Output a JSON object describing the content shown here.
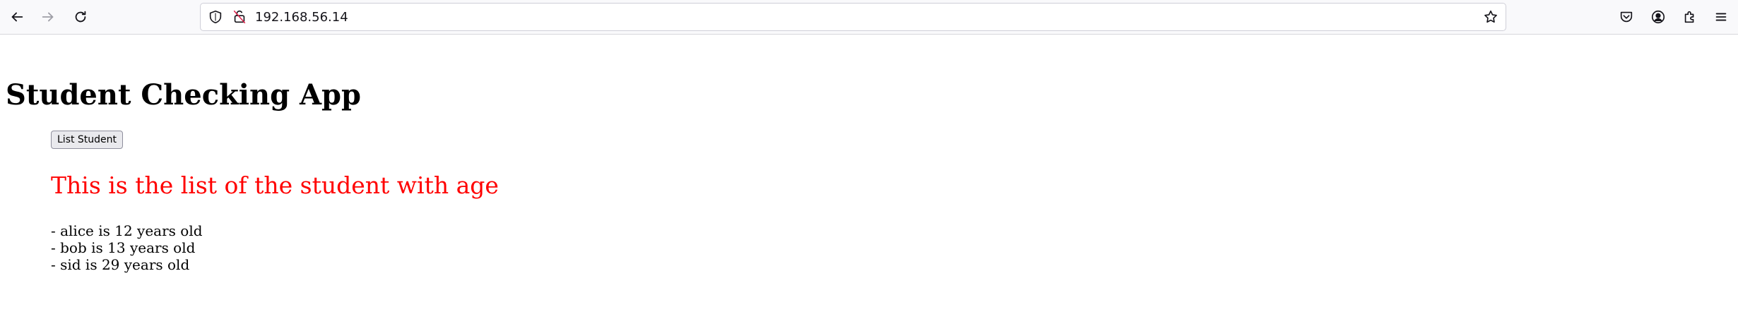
{
  "browser": {
    "url": "192.168.56.14",
    "icons": [
      "back-arrow-icon",
      "forward-arrow-icon",
      "reload-icon",
      "shield-icon",
      "insecure-lock-icon",
      "bookmark-star-icon",
      "pocket-icon",
      "account-icon",
      "extensions-icon",
      "menu-icon"
    ]
  },
  "page": {
    "title": "Student Checking App",
    "list_button_label": "List Student",
    "list_heading": "This is the list of the student with age",
    "heading_color": "#ff0000",
    "students": [
      "- alice is 12 years old",
      "- bob is 13 years old",
      "- sid is 29 years old"
    ]
  }
}
